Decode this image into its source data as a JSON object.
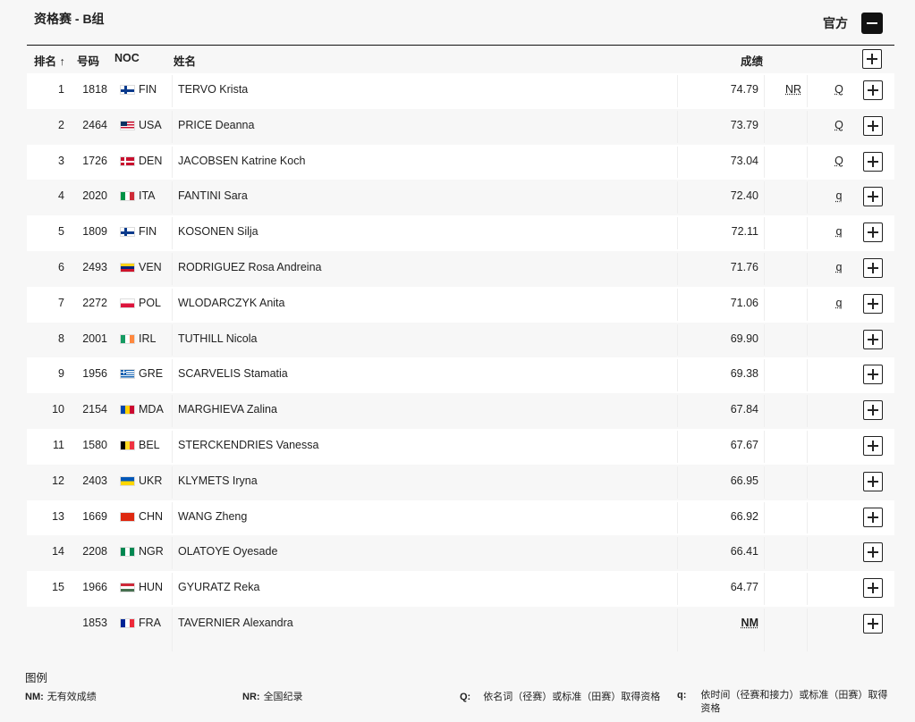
{
  "header": {
    "title": "资格赛 - B组",
    "official": "官方"
  },
  "columns": {
    "rank": "排名 ↑",
    "bib": "号码",
    "noc": "NOC",
    "name": "姓名",
    "mark": "成绩"
  },
  "rows": [
    {
      "rank": "1",
      "bib": "1818",
      "noc": "FIN",
      "flag": "fin-flag",
      "name": "TERVO Krista",
      "mark": "74.79",
      "record": "NR",
      "q": "Q"
    },
    {
      "rank": "2",
      "bib": "2464",
      "noc": "USA",
      "flag": "usa-flag",
      "name": "PRICE Deanna",
      "mark": "73.79",
      "record": "",
      "q": "Q"
    },
    {
      "rank": "3",
      "bib": "1726",
      "noc": "DEN",
      "flag": "den-flag",
      "name": "JACOBSEN Katrine Koch",
      "mark": "73.04",
      "record": "",
      "q": "Q"
    },
    {
      "rank": "4",
      "bib": "2020",
      "noc": "ITA",
      "flag": "ita-flag",
      "name": "FANTINI Sara",
      "mark": "72.40",
      "record": "",
      "q": "q"
    },
    {
      "rank": "5",
      "bib": "1809",
      "noc": "FIN",
      "flag": "fin-flag",
      "name": "KOSONEN Silja",
      "mark": "72.11",
      "record": "",
      "q": "q"
    },
    {
      "rank": "6",
      "bib": "2493",
      "noc": "VEN",
      "flag": "ven-flag",
      "name": "RODRIGUEZ Rosa Andreina",
      "mark": "71.76",
      "record": "",
      "q": "q"
    },
    {
      "rank": "7",
      "bib": "2272",
      "noc": "POL",
      "flag": "pol-flag",
      "name": "WLODARCZYK Anita",
      "mark": "71.06",
      "record": "",
      "q": "q"
    },
    {
      "rank": "8",
      "bib": "2001",
      "noc": "IRL",
      "flag": "irl-flag",
      "name": "TUTHILL Nicola",
      "mark": "69.90",
      "record": "",
      "q": ""
    },
    {
      "rank": "9",
      "bib": "1956",
      "noc": "GRE",
      "flag": "gre-flag",
      "name": "SCARVELIS Stamatia",
      "mark": "69.38",
      "record": "",
      "q": ""
    },
    {
      "rank": "10",
      "bib": "2154",
      "noc": "MDA",
      "flag": "mda-flag",
      "name": "MARGHIEVA Zalina",
      "mark": "67.84",
      "record": "",
      "q": ""
    },
    {
      "rank": "11",
      "bib": "1580",
      "noc": "BEL",
      "flag": "bel-flag",
      "name": "STERCKENDRIES Vanessa",
      "mark": "67.67",
      "record": "",
      "q": ""
    },
    {
      "rank": "12",
      "bib": "2403",
      "noc": "UKR",
      "flag": "ukr-flag",
      "name": "KLYMETS Iryna",
      "mark": "66.95",
      "record": "",
      "q": ""
    },
    {
      "rank": "13",
      "bib": "1669",
      "noc": "CHN",
      "flag": "chn-flag",
      "name": "WANG Zheng",
      "mark": "66.92",
      "record": "",
      "q": ""
    },
    {
      "rank": "14",
      "bib": "2208",
      "noc": "NGR",
      "flag": "ngr-flag",
      "name": "OLATOYE Oyesade",
      "mark": "66.41",
      "record": "",
      "q": ""
    },
    {
      "rank": "15",
      "bib": "1966",
      "noc": "HUN",
      "flag": "hun-flag",
      "name": "GYURATZ Reka",
      "mark": "64.77",
      "record": "",
      "q": ""
    },
    {
      "rank": "",
      "bib": "1853",
      "noc": "FRA",
      "flag": "fra-flag",
      "name": "TAVERNIER Alexandra",
      "mark": "NM",
      "record": "",
      "q": ""
    }
  ],
  "legend": {
    "title": "图例",
    "items": [
      {
        "code": "NM:",
        "text": "无有效成绩"
      },
      {
        "code": "NR:",
        "text": "全国纪录"
      },
      {
        "code": "Q:",
        "text": "依名词（径赛）或标准（田赛）取得资格"
      },
      {
        "code": "q:",
        "text": "依时间（径赛和接力）或标准（田赛）取得资格"
      }
    ]
  }
}
